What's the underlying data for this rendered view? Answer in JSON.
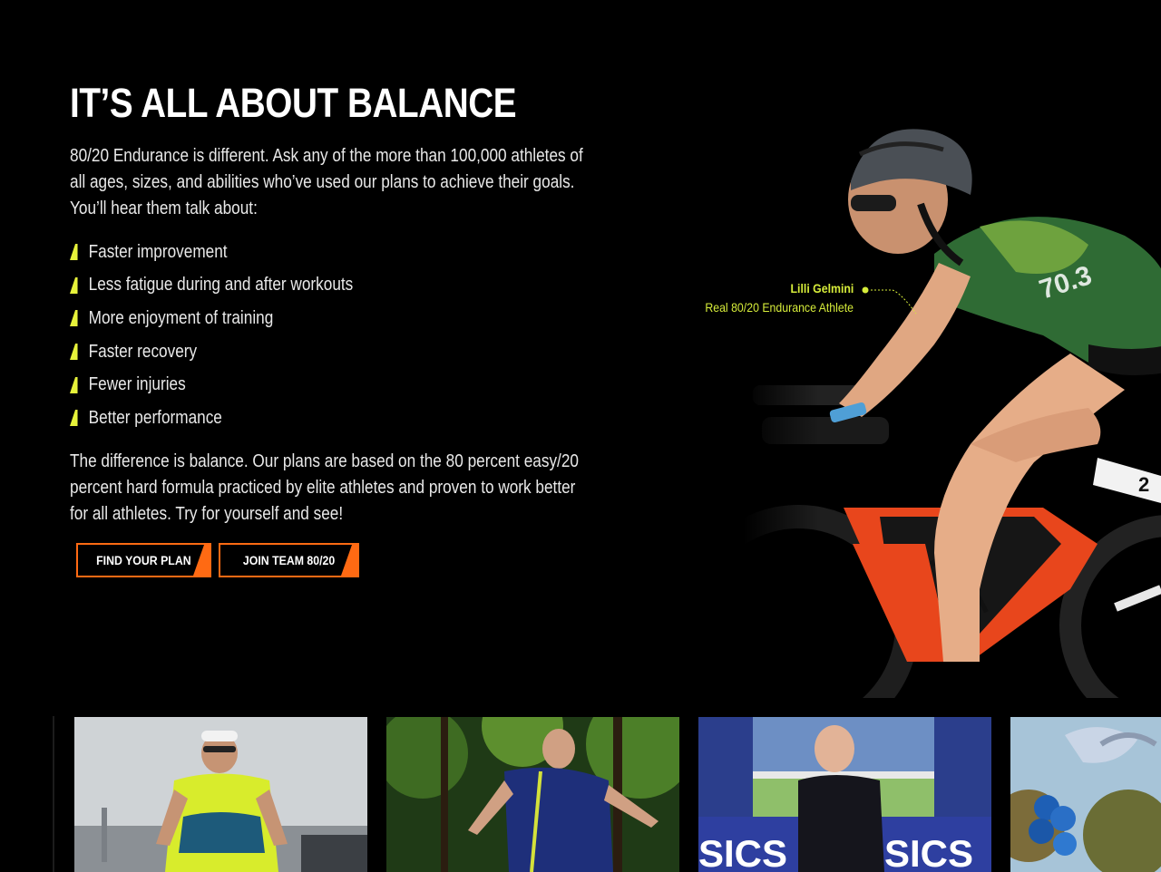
{
  "hero": {
    "title": "IT’S ALL ABOUT BALANCE",
    "intro": "80/20 Endurance is different. Ask any of the more than 100,000 athletes of all ages, sizes, and abilities who’ve used our plans to achieve their goals. You’ll hear them talk about:",
    "benefits": [
      "Faster improvement",
      "Less fatigue during and after workouts",
      "More enjoyment of training",
      "Faster recovery",
      "Fewer injuries",
      "Better performance"
    ],
    "outro": "The difference is balance. Our plans are based on the 80 percent easy/20 percent hard formula practiced by elite athletes and proven to work better for all athletes. Try for yourself and see!",
    "buttons": {
      "find_plan": "FIND YOUR PLAN",
      "join_team": "JOIN TEAM 80/20"
    }
  },
  "athlete_caption": {
    "name": "Lilli Gelmini",
    "subtitle": "Real 80/20 Endurance Athlete"
  },
  "gallery": {
    "items": [
      "runner-photo",
      "trail-runner-photo",
      "finish-line-photo",
      "balloons-photo"
    ]
  },
  "colors": {
    "background": "#000000",
    "accent_orange": "#ff6a13",
    "accent_yellow": "#d6ec3a",
    "bullet_yellow": "#e6f23a"
  }
}
